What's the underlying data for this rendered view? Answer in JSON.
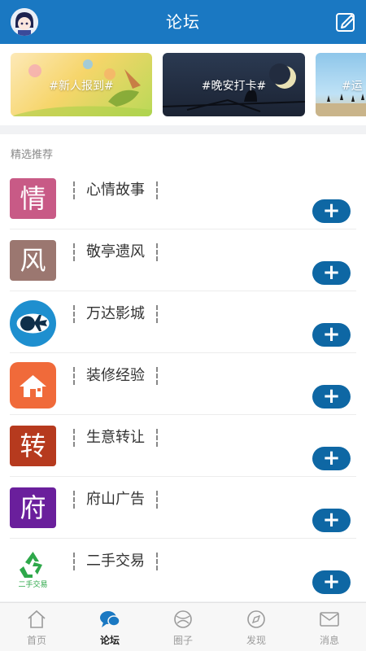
{
  "header": {
    "title": "论坛",
    "avatar_icon": "user-avatar",
    "compose_icon": "compose-icon"
  },
  "banners": [
    {
      "tag": "#新人报到#"
    },
    {
      "tag": "#晚安打卡#"
    },
    {
      "tag": "#运"
    }
  ],
  "section": {
    "label": "精选推荐"
  },
  "forums": [
    {
      "name": "心情故事",
      "icon_char": "情",
      "icon_color": "#c85a86"
    },
    {
      "name": "敬亭遗风",
      "icon_char": "风",
      "icon_color": "#9b7770"
    },
    {
      "name": "万达影城",
      "icon_char": "",
      "icon_color": "#1e8fcf",
      "icon": "plane-globe-icon"
    },
    {
      "name": "装修经验",
      "icon_char": "",
      "icon_color": "#f06a3a",
      "icon": "house-icon"
    },
    {
      "name": "生意转让",
      "icon_char": "转",
      "icon_color": "#b63a1e"
    },
    {
      "name": "府山广告",
      "icon_char": "府",
      "icon_color": "#6a1f9c"
    },
    {
      "name": "二手交易",
      "icon_char": "",
      "icon_color": "#ffffff",
      "icon": "recycle-icon",
      "icon_text": "二手交易"
    }
  ],
  "follow_button": {
    "label": "+"
  },
  "tabs": [
    {
      "label": "首页",
      "icon": "home-icon",
      "active": false
    },
    {
      "label": "论坛",
      "icon": "forum-chat-icon",
      "active": true
    },
    {
      "label": "圈子",
      "icon": "circle-icon",
      "active": false
    },
    {
      "label": "发现",
      "icon": "compass-icon",
      "active": false
    },
    {
      "label": "消息",
      "icon": "mail-icon",
      "active": false
    }
  ],
  "colors": {
    "brand": "#1a78c2",
    "button": "#0e67a4"
  }
}
